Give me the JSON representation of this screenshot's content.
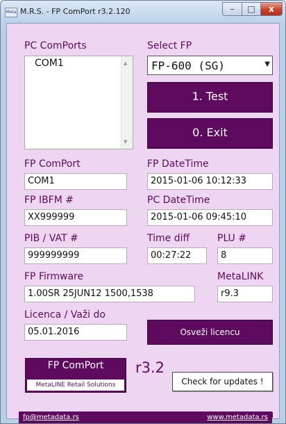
{
  "window": {
    "title": "M.R.S. - FP ComPort r3.2.120",
    "icon": "Meta",
    "controls": {
      "minimize": "–",
      "maximize": "□",
      "close": "x"
    }
  },
  "comports": {
    "label": "PC ComPorts",
    "items": [
      "COM1"
    ]
  },
  "select_fp": {
    "label": "Select FP",
    "value": "FP-600 (SG)"
  },
  "buttons": {
    "test": "1. Test",
    "exit": "0. Exit",
    "refresh_licence": "Osveži licencu",
    "check_updates": "Check for updates !"
  },
  "fields": {
    "fp_comport": {
      "label": "FP ComPort",
      "value": "COM1"
    },
    "fp_datetime": {
      "label": "FP DateTime",
      "value": "2015-01-06 10:12:33"
    },
    "fp_ibfm": {
      "label": "FP IBFM #",
      "value": "XX999999"
    },
    "pc_datetime": {
      "label": "PC DateTime",
      "value": "2015-01-06 09:45:10"
    },
    "pib_vat": {
      "label": "PIB / VAT #",
      "value": "999999999"
    },
    "time_diff": {
      "label": "Time diff",
      "value": "00:27:22"
    },
    "plu": {
      "label": "PLU #",
      "value": "8"
    },
    "fp_firmware": {
      "label": "FP Firmware",
      "value": "1.00SR 25JUN12 1500,1538"
    },
    "metalink": {
      "label": "MetaLINK",
      "value": "r9.3"
    },
    "licence": {
      "label": "Licenca / Važi do",
      "value": "05.01.2016"
    }
  },
  "brand": {
    "title": "FP ComPort",
    "subtitle": "MetaLINE Retail Solutions",
    "version": "r3.2"
  },
  "footer": {
    "email": "fp@metadata.rs",
    "website": "www.metadata.rs"
  },
  "colors": {
    "accent": "#5e0a5e",
    "background": "#eed6f2",
    "label": "#5c0a5c"
  }
}
